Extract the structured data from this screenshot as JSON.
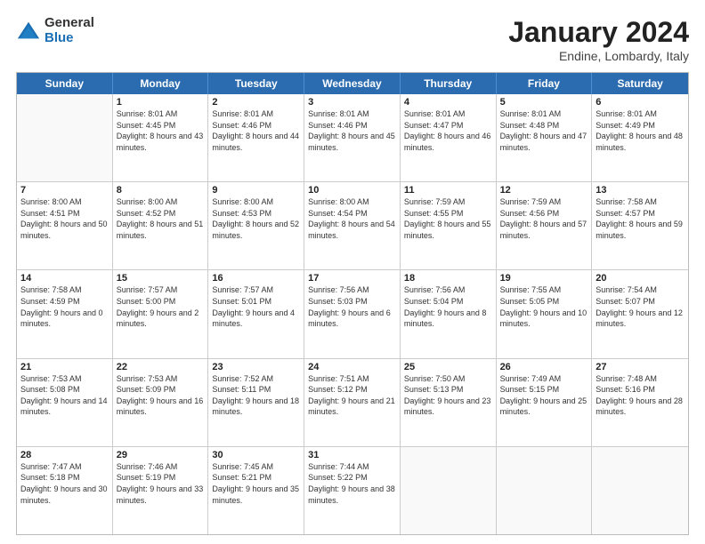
{
  "logo": {
    "general": "General",
    "blue": "Blue"
  },
  "title": "January 2024",
  "location": "Endine, Lombardy, Italy",
  "days": [
    "Sunday",
    "Monday",
    "Tuesday",
    "Wednesday",
    "Thursday",
    "Friday",
    "Saturday"
  ],
  "weeks": [
    [
      {
        "day": "",
        "sunrise": "",
        "sunset": "",
        "daylight": ""
      },
      {
        "day": "1",
        "sunrise": "Sunrise: 8:01 AM",
        "sunset": "Sunset: 4:45 PM",
        "daylight": "Daylight: 8 hours and 43 minutes."
      },
      {
        "day": "2",
        "sunrise": "Sunrise: 8:01 AM",
        "sunset": "Sunset: 4:46 PM",
        "daylight": "Daylight: 8 hours and 44 minutes."
      },
      {
        "day": "3",
        "sunrise": "Sunrise: 8:01 AM",
        "sunset": "Sunset: 4:46 PM",
        "daylight": "Daylight: 8 hours and 45 minutes."
      },
      {
        "day": "4",
        "sunrise": "Sunrise: 8:01 AM",
        "sunset": "Sunset: 4:47 PM",
        "daylight": "Daylight: 8 hours and 46 minutes."
      },
      {
        "day": "5",
        "sunrise": "Sunrise: 8:01 AM",
        "sunset": "Sunset: 4:48 PM",
        "daylight": "Daylight: 8 hours and 47 minutes."
      },
      {
        "day": "6",
        "sunrise": "Sunrise: 8:01 AM",
        "sunset": "Sunset: 4:49 PM",
        "daylight": "Daylight: 8 hours and 48 minutes."
      }
    ],
    [
      {
        "day": "7",
        "sunrise": "Sunrise: 8:00 AM",
        "sunset": "Sunset: 4:51 PM",
        "daylight": "Daylight: 8 hours and 50 minutes."
      },
      {
        "day": "8",
        "sunrise": "Sunrise: 8:00 AM",
        "sunset": "Sunset: 4:52 PM",
        "daylight": "Daylight: 8 hours and 51 minutes."
      },
      {
        "day": "9",
        "sunrise": "Sunrise: 8:00 AM",
        "sunset": "Sunset: 4:53 PM",
        "daylight": "Daylight: 8 hours and 52 minutes."
      },
      {
        "day": "10",
        "sunrise": "Sunrise: 8:00 AM",
        "sunset": "Sunset: 4:54 PM",
        "daylight": "Daylight: 8 hours and 54 minutes."
      },
      {
        "day": "11",
        "sunrise": "Sunrise: 7:59 AM",
        "sunset": "Sunset: 4:55 PM",
        "daylight": "Daylight: 8 hours and 55 minutes."
      },
      {
        "day": "12",
        "sunrise": "Sunrise: 7:59 AM",
        "sunset": "Sunset: 4:56 PM",
        "daylight": "Daylight: 8 hours and 57 minutes."
      },
      {
        "day": "13",
        "sunrise": "Sunrise: 7:58 AM",
        "sunset": "Sunset: 4:57 PM",
        "daylight": "Daylight: 8 hours and 59 minutes."
      }
    ],
    [
      {
        "day": "14",
        "sunrise": "Sunrise: 7:58 AM",
        "sunset": "Sunset: 4:59 PM",
        "daylight": "Daylight: 9 hours and 0 minutes."
      },
      {
        "day": "15",
        "sunrise": "Sunrise: 7:57 AM",
        "sunset": "Sunset: 5:00 PM",
        "daylight": "Daylight: 9 hours and 2 minutes."
      },
      {
        "day": "16",
        "sunrise": "Sunrise: 7:57 AM",
        "sunset": "Sunset: 5:01 PM",
        "daylight": "Daylight: 9 hours and 4 minutes."
      },
      {
        "day": "17",
        "sunrise": "Sunrise: 7:56 AM",
        "sunset": "Sunset: 5:03 PM",
        "daylight": "Daylight: 9 hours and 6 minutes."
      },
      {
        "day": "18",
        "sunrise": "Sunrise: 7:56 AM",
        "sunset": "Sunset: 5:04 PM",
        "daylight": "Daylight: 9 hours and 8 minutes."
      },
      {
        "day": "19",
        "sunrise": "Sunrise: 7:55 AM",
        "sunset": "Sunset: 5:05 PM",
        "daylight": "Daylight: 9 hours and 10 minutes."
      },
      {
        "day": "20",
        "sunrise": "Sunrise: 7:54 AM",
        "sunset": "Sunset: 5:07 PM",
        "daylight": "Daylight: 9 hours and 12 minutes."
      }
    ],
    [
      {
        "day": "21",
        "sunrise": "Sunrise: 7:53 AM",
        "sunset": "Sunset: 5:08 PM",
        "daylight": "Daylight: 9 hours and 14 minutes."
      },
      {
        "day": "22",
        "sunrise": "Sunrise: 7:53 AM",
        "sunset": "Sunset: 5:09 PM",
        "daylight": "Daylight: 9 hours and 16 minutes."
      },
      {
        "day": "23",
        "sunrise": "Sunrise: 7:52 AM",
        "sunset": "Sunset: 5:11 PM",
        "daylight": "Daylight: 9 hours and 18 minutes."
      },
      {
        "day": "24",
        "sunrise": "Sunrise: 7:51 AM",
        "sunset": "Sunset: 5:12 PM",
        "daylight": "Daylight: 9 hours and 21 minutes."
      },
      {
        "day": "25",
        "sunrise": "Sunrise: 7:50 AM",
        "sunset": "Sunset: 5:13 PM",
        "daylight": "Daylight: 9 hours and 23 minutes."
      },
      {
        "day": "26",
        "sunrise": "Sunrise: 7:49 AM",
        "sunset": "Sunset: 5:15 PM",
        "daylight": "Daylight: 9 hours and 25 minutes."
      },
      {
        "day": "27",
        "sunrise": "Sunrise: 7:48 AM",
        "sunset": "Sunset: 5:16 PM",
        "daylight": "Daylight: 9 hours and 28 minutes."
      }
    ],
    [
      {
        "day": "28",
        "sunrise": "Sunrise: 7:47 AM",
        "sunset": "Sunset: 5:18 PM",
        "daylight": "Daylight: 9 hours and 30 minutes."
      },
      {
        "day": "29",
        "sunrise": "Sunrise: 7:46 AM",
        "sunset": "Sunset: 5:19 PM",
        "daylight": "Daylight: 9 hours and 33 minutes."
      },
      {
        "day": "30",
        "sunrise": "Sunrise: 7:45 AM",
        "sunset": "Sunset: 5:21 PM",
        "daylight": "Daylight: 9 hours and 35 minutes."
      },
      {
        "day": "31",
        "sunrise": "Sunrise: 7:44 AM",
        "sunset": "Sunset: 5:22 PM",
        "daylight": "Daylight: 9 hours and 38 minutes."
      },
      {
        "day": "",
        "sunrise": "",
        "sunset": "",
        "daylight": ""
      },
      {
        "day": "",
        "sunrise": "",
        "sunset": "",
        "daylight": ""
      },
      {
        "day": "",
        "sunrise": "",
        "sunset": "",
        "daylight": ""
      }
    ]
  ]
}
